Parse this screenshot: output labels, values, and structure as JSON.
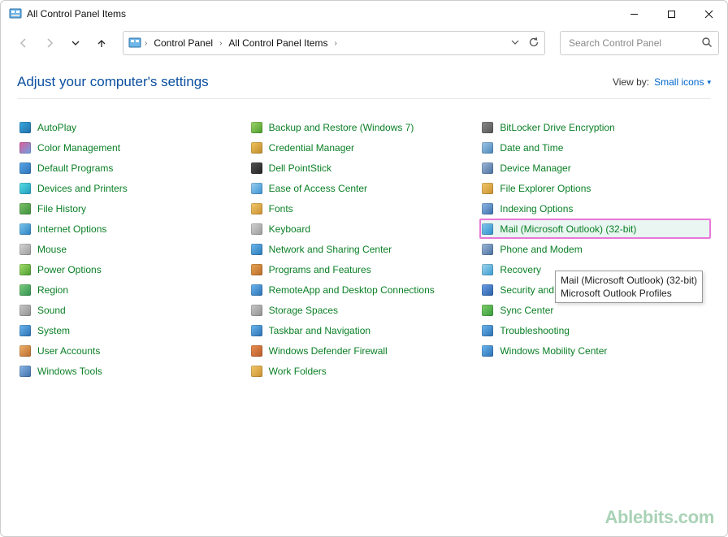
{
  "window": {
    "title": "All Control Panel Items"
  },
  "breadcrumb": {
    "root": "Control Panel",
    "current": "All Control Panel Items"
  },
  "search": {
    "placeholder": "Search Control Panel"
  },
  "header": {
    "heading": "Adjust your computer's settings",
    "viewby_label": "View by:",
    "viewby_value": "Small icons"
  },
  "items": [
    {
      "label": "AutoPlay",
      "c1": "#3aa9e0",
      "c2": "#1f6ea8"
    },
    {
      "label": "Color Management",
      "c1": "#e05a9a",
      "c2": "#6aa4e2"
    },
    {
      "label": "Default Programs",
      "c1": "#5aa7e8",
      "c2": "#2c70b6"
    },
    {
      "label": "Devices and Printers",
      "c1": "#5adfe6",
      "c2": "#1f9abc"
    },
    {
      "label": "File History",
      "c1": "#7dc26b",
      "c2": "#3b8e3a"
    },
    {
      "label": "Internet Options",
      "c1": "#7cc8ef",
      "c2": "#2a7fbf"
    },
    {
      "label": "Mouse",
      "c1": "#d7d7d7",
      "c2": "#9a9a9a"
    },
    {
      "label": "Power Options",
      "c1": "#a4e06c",
      "c2": "#4a9a2f"
    },
    {
      "label": "Region",
      "c1": "#7ecf80",
      "c2": "#2f8f4e"
    },
    {
      "label": "Sound",
      "c1": "#c9c9c9",
      "c2": "#8f8f8f"
    },
    {
      "label": "System",
      "c1": "#6cb7ef",
      "c2": "#2a6fb2"
    },
    {
      "label": "User Accounts",
      "c1": "#f0b26b",
      "c2": "#b86a2c"
    },
    {
      "label": "Windows Tools",
      "c1": "#8fb9e8",
      "c2": "#3c6ea8"
    },
    {
      "label": "Backup and Restore (Windows 7)",
      "c1": "#9fd66c",
      "c2": "#4a9a2a"
    },
    {
      "label": "Credential Manager",
      "c1": "#f0c45c",
      "c2": "#bf8a2c"
    },
    {
      "label": "Dell PointStick",
      "c1": "#555",
      "c2": "#222"
    },
    {
      "label": "Ease of Access Center",
      "c1": "#9ad1f2",
      "c2": "#3a8fcf"
    },
    {
      "label": "Fonts",
      "c1": "#f2c96a",
      "c2": "#c98f2f"
    },
    {
      "label": "Keyboard",
      "c1": "#d2d2d2",
      "c2": "#9a9a9a"
    },
    {
      "label": "Network and Sharing Center",
      "c1": "#6cb7ef",
      "c2": "#2a7ab6"
    },
    {
      "label": "Programs and Features",
      "c1": "#e8a551",
      "c2": "#b86a2c"
    },
    {
      "label": "RemoteApp and Desktop Connections",
      "c1": "#6cb7ef",
      "c2": "#2a6fb2"
    },
    {
      "label": "Storage Spaces",
      "c1": "#c9c9c9",
      "c2": "#8f8f8f"
    },
    {
      "label": "Taskbar and Navigation",
      "c1": "#6cb7ef",
      "c2": "#2a6fb2"
    },
    {
      "label": "Windows Defender Firewall",
      "c1": "#e88f4f",
      "c2": "#b85a2a"
    },
    {
      "label": "Work Folders",
      "c1": "#f2c96a",
      "c2": "#c98f2f"
    },
    {
      "label": "BitLocker Drive Encryption",
      "c1": "#8a8a8a",
      "c2": "#555"
    },
    {
      "label": "Date and Time",
      "c1": "#9fc7e8",
      "c2": "#4a86b8"
    },
    {
      "label": "Device Manager",
      "c1": "#9fb9d9",
      "c2": "#4a6fa0"
    },
    {
      "label": "File Explorer Options",
      "c1": "#f2c96a",
      "c2": "#c98f2f"
    },
    {
      "label": "Indexing Options",
      "c1": "#8fb9e8",
      "c2": "#3c6ea8"
    },
    {
      "label": "Mail (Microsoft Outlook) (32-bit)",
      "c1": "#85c8ef",
      "c2": "#2f8fc9",
      "highlight": true
    },
    {
      "label": "Phone and Modem",
      "c1": "#9fb9d9",
      "c2": "#4a6fa0"
    },
    {
      "label": "Recovery",
      "c1": "#9fd7ef",
      "c2": "#3a9acf"
    },
    {
      "label": "Security and Maintenance",
      "c1": "#6a9fe8",
      "c2": "#2a5fa8"
    },
    {
      "label": "Sync Center",
      "c1": "#7dcf6a",
      "c2": "#3a9a3a"
    },
    {
      "label": "Troubleshooting",
      "c1": "#6cb7ef",
      "c2": "#2a6fb2"
    },
    {
      "label": "Windows Mobility Center",
      "c1": "#6cb7ef",
      "c2": "#2a6fb2"
    }
  ],
  "tooltip": {
    "line1": "Mail (Microsoft Outlook) (32-bit)",
    "line2": "Microsoft Outlook Profiles"
  },
  "watermark": "Ablebits.com"
}
